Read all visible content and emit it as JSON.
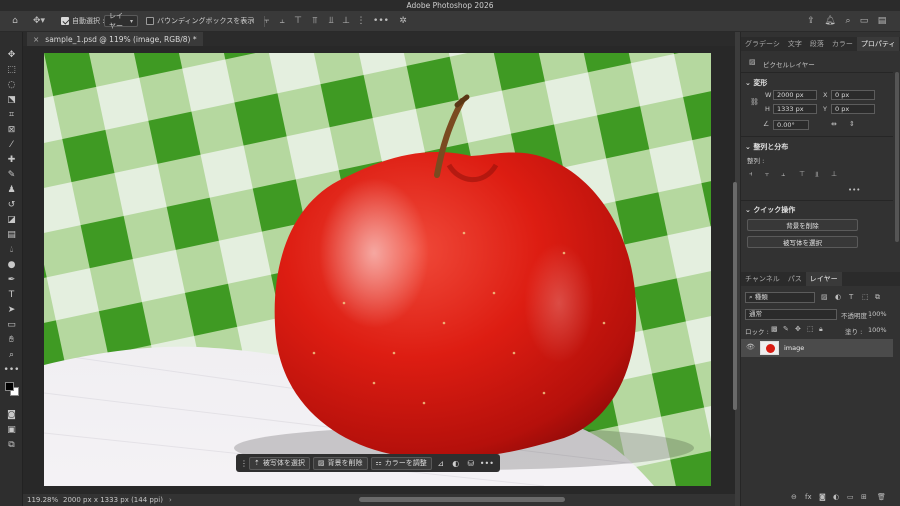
{
  "window": {
    "title": "Adobe Photoshop 2026"
  },
  "options_bar": {
    "auto_select_label": "自動選択 :",
    "auto_select_target": "レイヤー",
    "show_bounding_box_label": "バウンディングボックスを表示"
  },
  "document": {
    "tab_title": "sample_1.psd @ 119% (image, RGB/8) *",
    "close_glyph": "×"
  },
  "taskbar": {
    "select_subject": "被写体を選択",
    "remove_background": "背景を削除",
    "adjust_color": "カラーを調整"
  },
  "status_bar": {
    "zoom": "119.28%",
    "doc_info": "2000 px x 1333 px (144 ppi)"
  },
  "panels": {
    "top_tabs": [
      "グラデーシ",
      "文字",
      "段落",
      "カラー",
      "プロパティ"
    ],
    "properties": {
      "layer_type": "ピクセルレイヤー",
      "transform_header": "変形",
      "w_label": "W",
      "w_value": "2000 px",
      "h_label": "H",
      "h_value": "1333 px",
      "x_label": "X",
      "x_value": "0 px",
      "y_label": "Y",
      "y_value": "0 px",
      "angle_value": "0.00°",
      "align_header": "整列と分布",
      "align_label": "整列 :",
      "quick_actions_header": "クイック操作",
      "remove_bg_button": "背景を削除",
      "select_subject_button": "被写体を選択",
      "more": "•••"
    },
    "layers_tabs": [
      "チャンネル",
      "パス",
      "レイヤー"
    ],
    "layers": {
      "filter_kind": "種類",
      "blend_mode": "通常",
      "opacity_label": "不透明度 :",
      "opacity_value": "100%",
      "lock_label": "ロック :",
      "fill_label": "塗り :",
      "fill_value": "100%",
      "items": [
        {
          "name": "image",
          "visible": true
        }
      ]
    }
  },
  "colors": {
    "accent_green": "#4c9a2a",
    "apple_red": "#d81b12"
  }
}
